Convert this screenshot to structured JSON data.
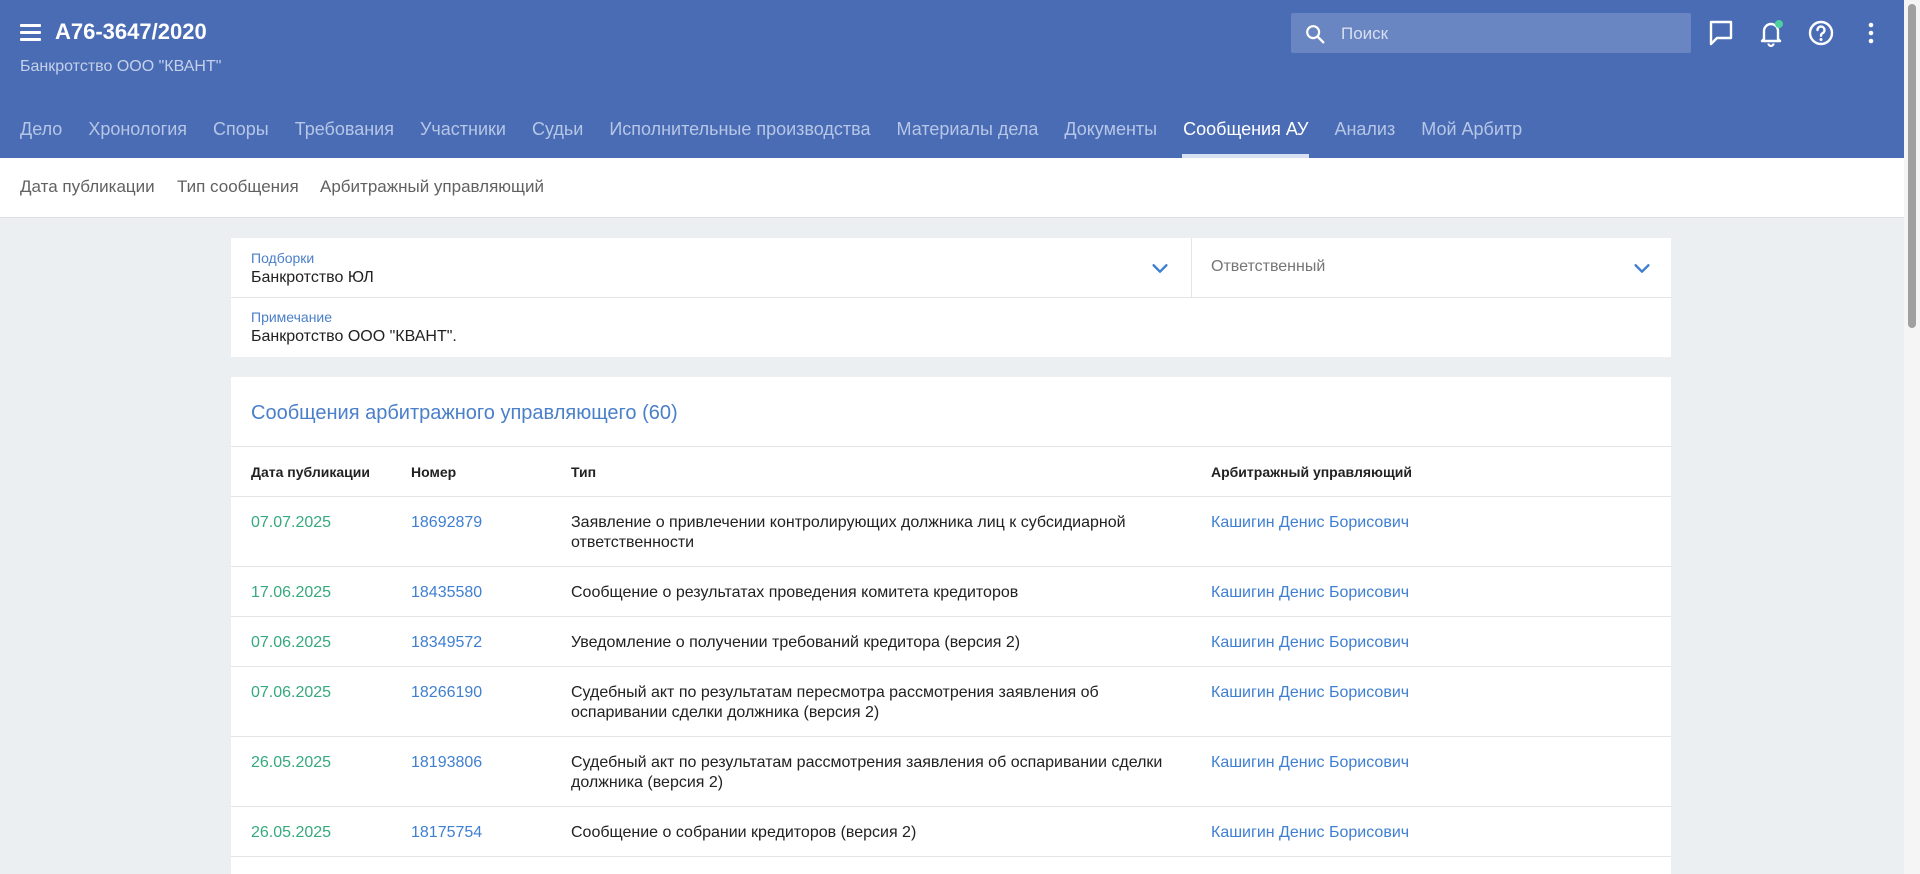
{
  "header": {
    "case_number": "А76-3647/2020",
    "subtitle": "Банкротство ООО \"КВАНТ\"",
    "search_placeholder": "Поиск",
    "accent_color": "#4a6cb5",
    "icons": [
      "menu-icon",
      "search-icon",
      "chat-icon",
      "bell-icon",
      "help-icon",
      "more-vert-icon"
    ]
  },
  "tabs": [
    {
      "label": "Дело",
      "active": false
    },
    {
      "label": "Хронология",
      "active": false
    },
    {
      "label": "Споры",
      "active": false
    },
    {
      "label": "Требования",
      "active": false
    },
    {
      "label": "Участники",
      "active": false
    },
    {
      "label": "Судьи",
      "active": false
    },
    {
      "label": "Исполнительные производства",
      "active": false
    },
    {
      "label": "Материалы дела",
      "active": false
    },
    {
      "label": "Документы",
      "active": false
    },
    {
      "label": "Сообщения АУ",
      "active": true
    },
    {
      "label": "Анализ",
      "active": false
    },
    {
      "label": "Мой Арбитр",
      "active": false
    }
  ],
  "subnav": [
    "Дата публикации",
    "Тип сообщения",
    "Арбитражный управляющий"
  ],
  "filters": {
    "collections_label": "Подборки",
    "collections_value": "Банкротство ЮЛ",
    "responsible_placeholder": "Ответственный",
    "note_label": "Примечание",
    "note_value": "Банкротство ООО \"КВАНТ\"."
  },
  "messages": {
    "title": "Сообщения арбитражного управляющего (60)",
    "columns": {
      "date": "Дата публикации",
      "number": "Номер",
      "type": "Тип",
      "manager": "Арбитражный управляющий"
    },
    "rows": [
      {
        "date": "07.07.2025",
        "number": "18692879",
        "type": "Заявление о привлечении контролирующих должника лиц к субсидиарной ответственности",
        "manager": "Кашигин Денис Борисович"
      },
      {
        "date": "17.06.2025",
        "number": "18435580",
        "type": "Сообщение о результатах проведения комитета кредиторов",
        "manager": "Кашигин Денис Борисович"
      },
      {
        "date": "07.06.2025",
        "number": "18349572",
        "type": "Уведомление о получении требований кредитора (версия 2)",
        "manager": "Кашигин Денис Борисович"
      },
      {
        "date": "07.06.2025",
        "number": "18266190",
        "type": "Судебный акт по результатам пересмотра рассмотрения заявления об оспаривании сделки должника (версия 2)",
        "manager": "Кашигин Денис Борисович"
      },
      {
        "date": "26.05.2025",
        "number": "18193806",
        "type": "Судебный акт по результатам рассмотрения заявления об оспаривании сделки должника (версия 2)",
        "manager": "Кашигин Денис Борисович"
      },
      {
        "date": "26.05.2025",
        "number": "18175754",
        "type": "Сообщение о собрании кредиторов (версия 2)",
        "manager": "Кашигин Денис Борисович"
      }
    ]
  }
}
